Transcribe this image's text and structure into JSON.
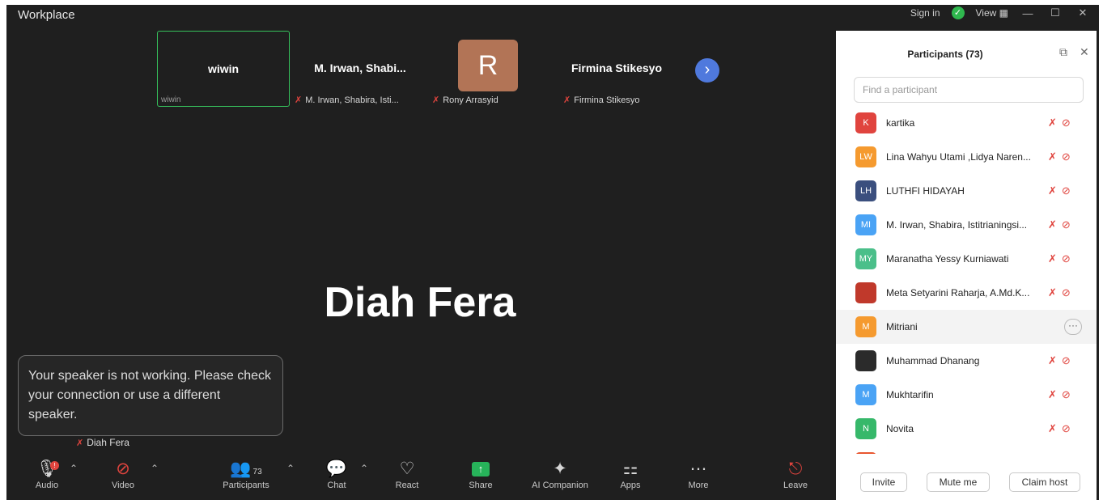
{
  "app": {
    "title": "Workplace"
  },
  "topbar": {
    "sign_in": "Sign in",
    "security_glyph": "✓",
    "view": "View",
    "view_glyph": "▦",
    "minimize": "—",
    "maximize": "☐",
    "close": "✕"
  },
  "thumbnails": [
    {
      "name": "wiwin",
      "caption": "wiwin"
    },
    {
      "name": "M. Irwan, Shabi...",
      "caption": "M. Irwan, Shabira, Isti..."
    },
    {
      "initial": "R",
      "caption": "Rony Arrasyid"
    },
    {
      "name": "Firmina Stikesyo",
      "caption": "Firmina Stikesyo"
    }
  ],
  "active_speaker": {
    "name": "Diah Fera",
    "caption": "Diah Fera"
  },
  "toast": {
    "text": "Your speaker is not working. Please check your connection or use a different speaker."
  },
  "toolbar": {
    "audio": "Audio",
    "audio_badge": "!",
    "video": "Video",
    "participants": "Participants",
    "participants_count": "73",
    "chat": "Chat",
    "react": "React",
    "share": "Share",
    "ai": "AI Companion",
    "apps": "Apps",
    "more": "More",
    "leave": "Leave"
  },
  "panel": {
    "title": "Participants (73)",
    "search_placeholder": "Find a participant",
    "participants": [
      {
        "initials": "K",
        "name": "kartika",
        "color": "#e0443e",
        "muted": true
      },
      {
        "initials": "LW",
        "name": "Lina Wahyu Utami ,Lidya Naren...",
        "color": "#f59a2f",
        "muted": true
      },
      {
        "initials": "LH",
        "name": "LUTHFI HIDAYAH",
        "color": "#3b4f7e",
        "muted": true
      },
      {
        "initials": "MI",
        "name": "M. Irwan, Shabira, Istitrianingsi...",
        "color": "#4aa3f5",
        "muted": true
      },
      {
        "initials": "MY",
        "name": "Maranatha Yessy Kurniawati",
        "color": "#4bbf8a",
        "muted": true
      },
      {
        "initials": "",
        "name": "Meta Setyarini Raharja, A.Md.K...",
        "color": "#c0392b",
        "muted": true
      },
      {
        "initials": "M",
        "name": "Mitriani",
        "color": "#f59a2f",
        "muted": false,
        "more": "···"
      },
      {
        "initials": "",
        "name": "Muhammad Dhanang",
        "color": "#2b2b2b",
        "muted": true
      },
      {
        "initials": "M",
        "name": "Mukhtarifin",
        "color": "#4aa3f5",
        "muted": true
      },
      {
        "initials": "N",
        "name": "Novita",
        "color": "#36b86a",
        "muted": true
      },
      {
        "initials": "",
        "name": "",
        "color": "#e8562f",
        "muted": true
      }
    ],
    "buttons": {
      "invite": "Invite",
      "mute_me": "Mute me",
      "claim_host": "Claim host"
    }
  },
  "colors": {
    "muted": "#e0443e",
    "active_border": "#36c15c",
    "share": "#27b35a"
  }
}
